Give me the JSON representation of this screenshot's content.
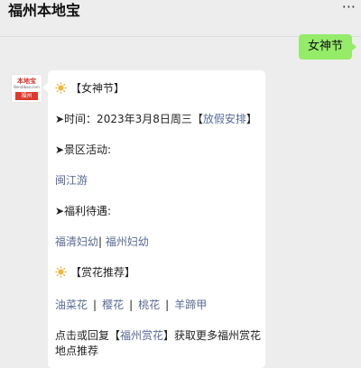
{
  "header": {
    "title": "福州本地宝",
    "more_icon": "more-icon"
  },
  "outgoing_message": "女神节",
  "avatar": {
    "top_text": "本地宝",
    "sub_text": "Bendibao.com",
    "city": "福州"
  },
  "message": {
    "sec1_title": "【女神节】",
    "time_prefix": "➤时间：2023年3月8日周三【",
    "time_link": "放假安排",
    "time_suffix": "】",
    "scenic_label": "➤景区活动:",
    "scenic_link": "闽江游",
    "welfare_label": "➤福利待遇:",
    "welfare_link1": "福清妇幼",
    "welfare_sep": "|",
    "welfare_link2": "福州妇幼",
    "sec2_title": "【赏花推荐】",
    "flower_links": [
      "油菜花",
      "樱花",
      "桃花",
      "羊蹄甲"
    ],
    "flower_sep": "|",
    "footer_prefix": "点击或回复【",
    "footer_link": "福州赏花",
    "footer_suffix": "】获取更多福州赏花",
    "footer_line2": "地点推荐"
  }
}
